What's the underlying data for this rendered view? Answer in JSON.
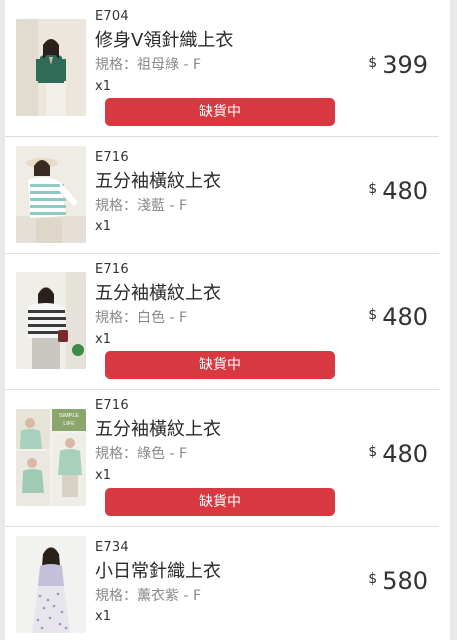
{
  "cart": {
    "currency": "$",
    "out_of_stock_label": "缺貨中",
    "items": [
      {
        "code": "E704",
        "name": "修身V領針織上衣",
        "spec": "規格：祖母綠 - F",
        "qty": "x1",
        "price": "399",
        "out_of_stock": true
      },
      {
        "code": "E716",
        "name": "五分袖橫紋上衣",
        "spec": "規格：淺藍 - F",
        "qty": "x1",
        "price": "480",
        "out_of_stock": false
      },
      {
        "code": "E716",
        "name": "五分袖橫紋上衣",
        "spec": "規格：白色 - F",
        "qty": "x1",
        "price": "480",
        "out_of_stock": true
      },
      {
        "code": "E716",
        "name": "五分袖橫紋上衣",
        "spec": "規格：綠色 - F",
        "qty": "x1",
        "price": "480",
        "out_of_stock": true,
        "thumb_text": "SIMPLE LIFE"
      },
      {
        "code": "E734",
        "name": "小日常針織上衣",
        "spec": "規格：薰衣紫 - F",
        "qty": "x1",
        "price": "580",
        "out_of_stock": false
      }
    ]
  }
}
